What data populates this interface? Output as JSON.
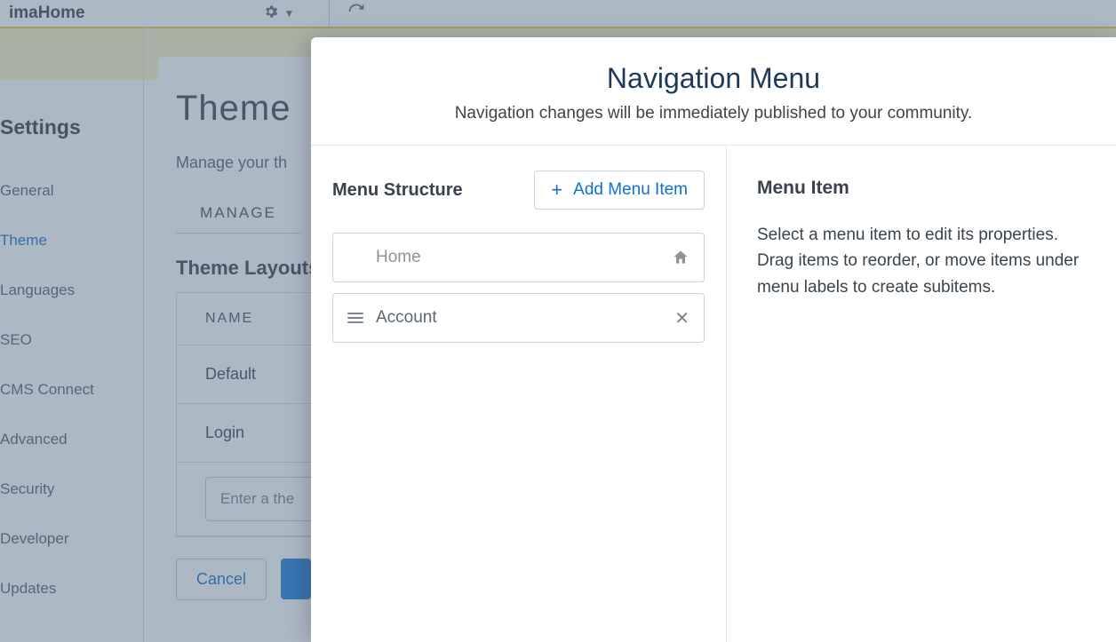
{
  "topbar": {
    "title": "imaHome"
  },
  "sidebar": {
    "title": "Settings",
    "items": [
      {
        "label": "General"
      },
      {
        "label": "Theme"
      },
      {
        "label": "Languages"
      },
      {
        "label": "SEO"
      },
      {
        "label": "CMS Connect"
      },
      {
        "label": "Advanced"
      },
      {
        "label": "Security"
      },
      {
        "label": "Developer"
      },
      {
        "label": "Updates"
      }
    ]
  },
  "content": {
    "heading": "Theme",
    "sub": "Manage your th",
    "tab": "MANAGE",
    "section": "Theme Layouts",
    "column": "NAME",
    "rows": [
      "Default",
      "Login"
    ],
    "input_placeholder": "Enter a the",
    "cancel": "Cancel"
  },
  "modal": {
    "title": "Navigation Menu",
    "subtitle": "Navigation changes will be immediately published to your community.",
    "left_label": "Menu Structure",
    "add_label": "Add Menu Item",
    "items": [
      {
        "label": "Home",
        "type": "home"
      },
      {
        "label": "Account",
        "type": "item"
      }
    ],
    "right_title": "Menu Item",
    "right_text": "Select a menu item to edit its properties. Drag items to reorder, or move items under menu labels to create subitems."
  }
}
